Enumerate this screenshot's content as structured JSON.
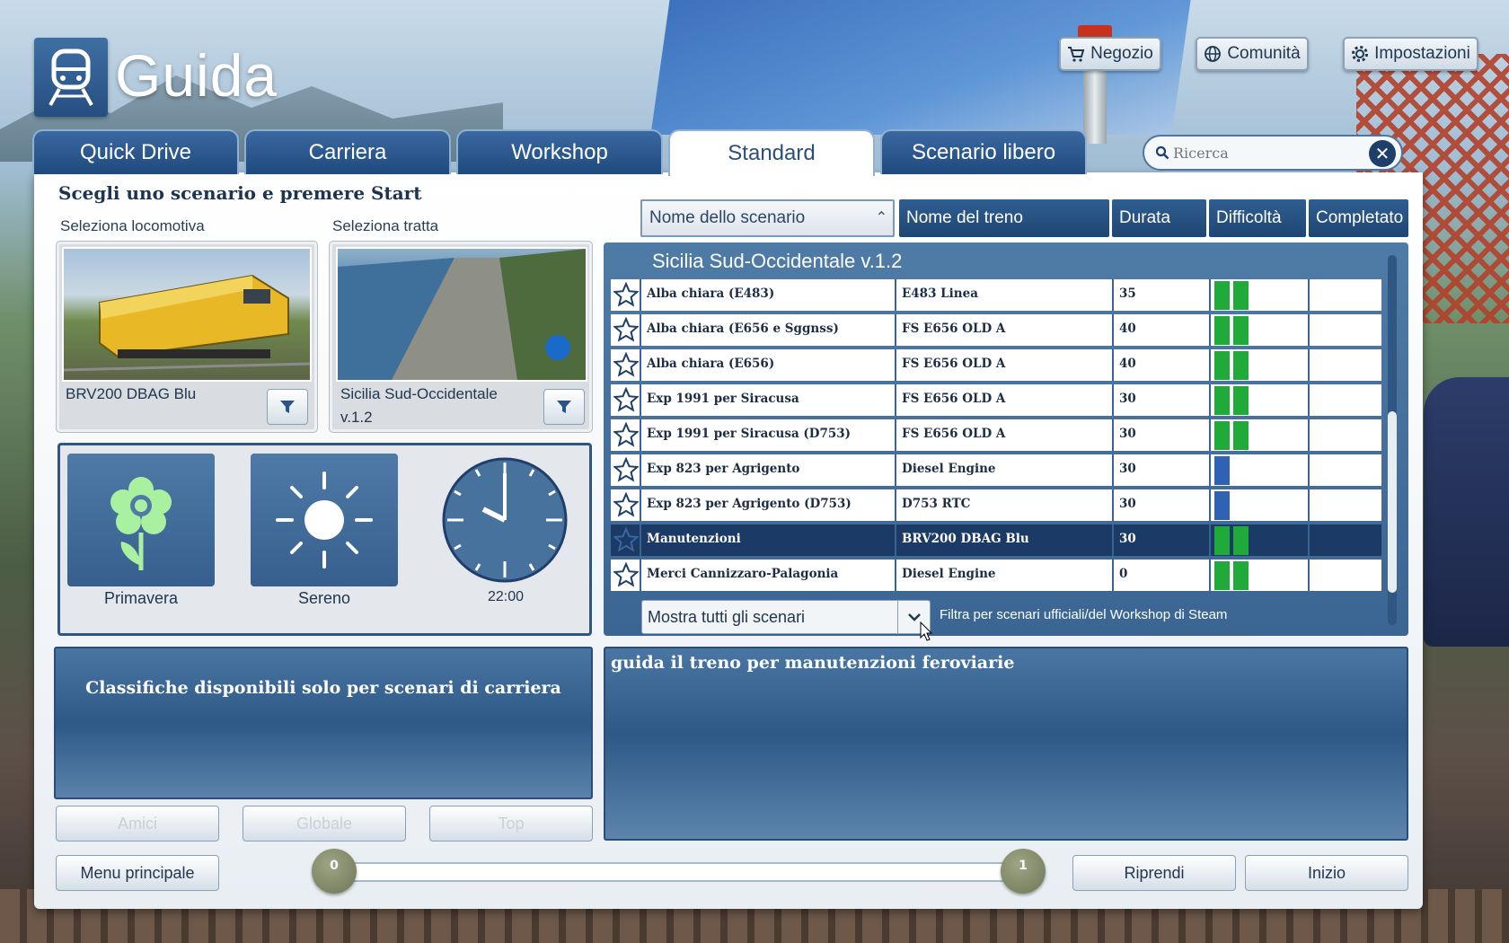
{
  "header": {
    "title": "Guida",
    "buttons": {
      "store": "Negozio",
      "community": "Comunità",
      "settings": "Impostazioni"
    }
  },
  "tabs": [
    {
      "label": "Quick Drive",
      "active": false
    },
    {
      "label": "Carriera",
      "active": false
    },
    {
      "label": "Workshop",
      "active": false
    },
    {
      "label": "Standard",
      "active": true
    },
    {
      "label": "Scenario libero",
      "active": false
    }
  ],
  "search": {
    "placeholder": "Ricerca",
    "value": ""
  },
  "instruction": "Scegli uno scenario e premere Start",
  "loco": {
    "label": "Seleziona locomotiva",
    "name": "BRV200 DBAG Blu"
  },
  "route": {
    "label": "Seleziona tratta",
    "name_line1": "Sicilia Sud-Occidentale",
    "name_line2": "v.1.2"
  },
  "environment": {
    "season": "Primavera",
    "weather": "Sereno",
    "time": "22:00"
  },
  "table": {
    "headers": [
      "Nome dello scenario",
      "Nome del treno",
      "Durata",
      "Difficoltà",
      "Completato"
    ],
    "group": "Sicilia Sud-Occidentale v.1.2",
    "rows": [
      {
        "name": "Alba chiara (E483)",
        "train": "E483 Linea",
        "duration": "35",
        "difficulty": 2,
        "selected": false
      },
      {
        "name": "Alba chiara (E656 e Sggnss)",
        "train": "FS E656 OLD A",
        "duration": "40",
        "difficulty": 2,
        "selected": false
      },
      {
        "name": "Alba chiara (E656)",
        "train": "FS E656 OLD A",
        "duration": "40",
        "difficulty": 2,
        "selected": false
      },
      {
        "name": "Exp 1991 per Siracusa",
        "train": "FS E656 OLD A",
        "duration": "30",
        "difficulty": 2,
        "selected": false
      },
      {
        "name": "Exp 1991 per Siracusa (D753)",
        "train": "FS E656 OLD A",
        "duration": "30",
        "difficulty": 2,
        "selected": false
      },
      {
        "name": "Exp 823 per Agrigento",
        "train": "Diesel Engine",
        "duration": "30",
        "difficulty": 1,
        "selected": false
      },
      {
        "name": "Exp 823 per Agrigento (D753)",
        "train": "D753 RTC",
        "duration": "30",
        "difficulty": 1,
        "selected": false
      },
      {
        "name": "Manutenzioni",
        "train": "BRV200 DBAG Blu",
        "duration": "30",
        "difficulty": 2,
        "selected": true
      },
      {
        "name": "Merci Cannizzaro-Palagonia",
        "train": "Diesel Engine",
        "duration": "0",
        "difficulty": 2,
        "selected": false
      }
    ]
  },
  "filter": {
    "selected": "Mostra tutti gli scenari",
    "hint": "Filtra per scenari ufficiali/del Workshop di Steam"
  },
  "leaderboard": {
    "message": "Classifiche disponibili solo per scenari di carriera",
    "buttons": [
      "Amici",
      "Globale",
      "Top"
    ]
  },
  "description": "guida il treno per manutenzioni feroviarie",
  "footer": {
    "main_menu": "Menu principale",
    "resume": "Riprendi",
    "start": "Inizio",
    "slider_min": "0",
    "slider_max": "1"
  },
  "colors": {
    "accent": "#2f5e91",
    "difficulty_green": "#1faa3a",
    "difficulty_blue": "#2f62b3"
  }
}
